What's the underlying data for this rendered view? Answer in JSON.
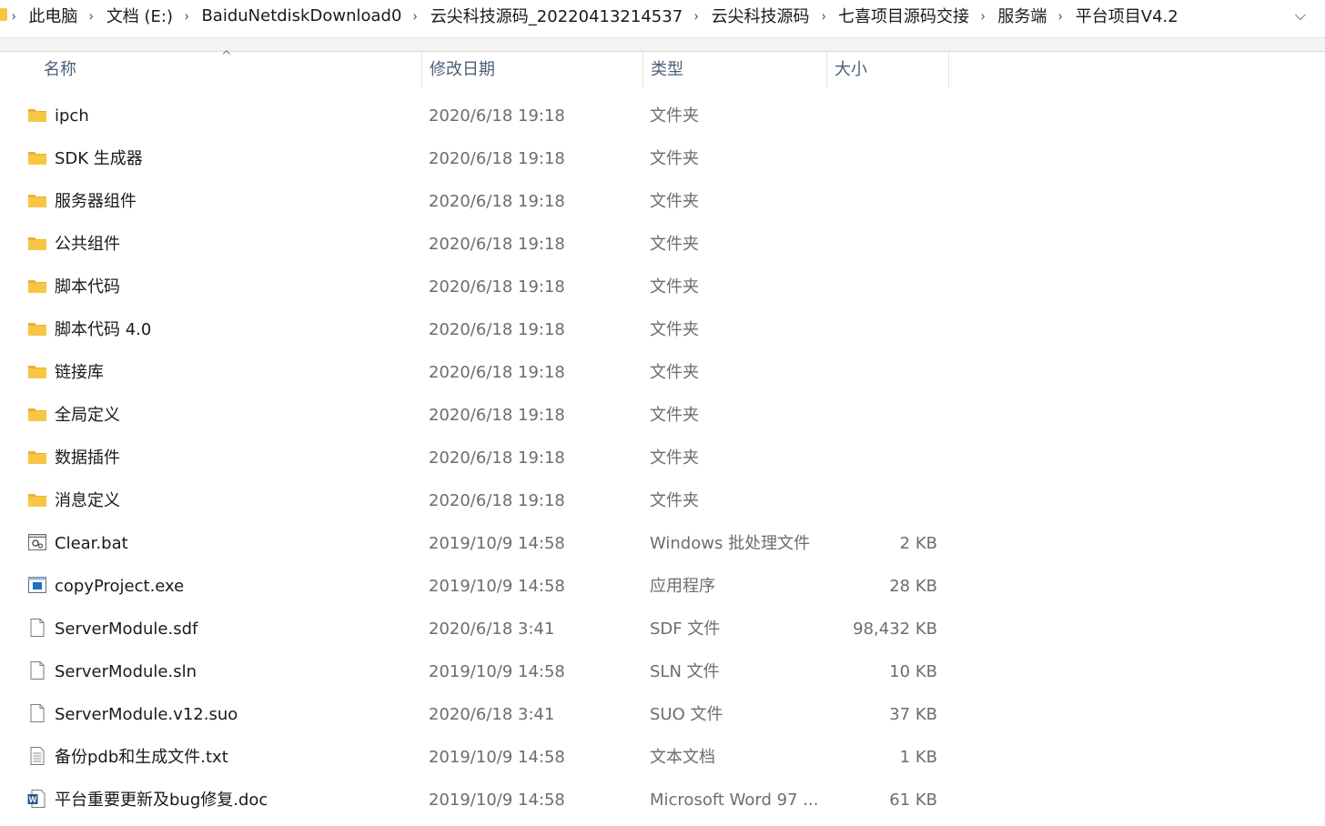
{
  "breadcrumb": {
    "items": [
      "此电脑",
      "文档 (E:)",
      "BaiduNetdiskDownload0",
      "云尖科技源码_20220413214537",
      "云尖科技源码",
      "七喜项目源码交接",
      "服务端",
      "平台项目V4.2"
    ],
    "separator": "›",
    "dropdown_glyph": "⌵"
  },
  "columns": {
    "name": "名称",
    "date": "修改日期",
    "type": "类型",
    "size": "大小",
    "sort_glyph": "^"
  },
  "files": [
    {
      "name": "ipch",
      "date": "2020/6/18 19:18",
      "type": "文件夹",
      "size": "",
      "icon": "folder-icon"
    },
    {
      "name": "SDK 生成器",
      "date": "2020/6/18 19:18",
      "type": "文件夹",
      "size": "",
      "icon": "folder-icon"
    },
    {
      "name": "服务器组件",
      "date": "2020/6/18 19:18",
      "type": "文件夹",
      "size": "",
      "icon": "folder-icon"
    },
    {
      "name": "公共组件",
      "date": "2020/6/18 19:18",
      "type": "文件夹",
      "size": "",
      "icon": "folder-icon"
    },
    {
      "name": "脚本代码",
      "date": "2020/6/18 19:18",
      "type": "文件夹",
      "size": "",
      "icon": "folder-icon"
    },
    {
      "name": "脚本代码 4.0",
      "date": "2020/6/18 19:18",
      "type": "文件夹",
      "size": "",
      "icon": "folder-icon"
    },
    {
      "name": "链接库",
      "date": "2020/6/18 19:18",
      "type": "文件夹",
      "size": "",
      "icon": "folder-icon"
    },
    {
      "name": "全局定义",
      "date": "2020/6/18 19:18",
      "type": "文件夹",
      "size": "",
      "icon": "folder-icon"
    },
    {
      "name": "数据插件",
      "date": "2020/6/18 19:18",
      "type": "文件夹",
      "size": "",
      "icon": "folder-icon"
    },
    {
      "name": "消息定义",
      "date": "2020/6/18 19:18",
      "type": "文件夹",
      "size": "",
      "icon": "folder-icon"
    },
    {
      "name": "Clear.bat",
      "date": "2019/10/9 14:58",
      "type": "Windows 批处理文件",
      "size": "2 KB",
      "icon": "batch-file-icon"
    },
    {
      "name": "copyProject.exe",
      "date": "2019/10/9 14:58",
      "type": "应用程序",
      "size": "28 KB",
      "icon": "executable-icon"
    },
    {
      "name": "ServerModule.sdf",
      "date": "2020/6/18 3:41",
      "type": "SDF 文件",
      "size": "98,432 KB",
      "icon": "blank-file-icon"
    },
    {
      "name": "ServerModule.sln",
      "date": "2019/10/9 14:58",
      "type": "SLN 文件",
      "size": "10 KB",
      "icon": "blank-file-icon"
    },
    {
      "name": "ServerModule.v12.suo",
      "date": "2020/6/18 3:41",
      "type": "SUO 文件",
      "size": "37 KB",
      "icon": "blank-file-icon"
    },
    {
      "name": "备份pdb和生成文件.txt",
      "date": "2019/10/9 14:58",
      "type": "文本文档",
      "size": "1 KB",
      "icon": "text-file-icon"
    },
    {
      "name": "平台重要更新及bug修复.doc",
      "date": "2019/10/9 14:58",
      "type": "Microsoft Word 97 ...",
      "size": "61 KB",
      "icon": "word-doc-icon"
    }
  ],
  "colors": {
    "folder": "#f7c744",
    "folder_dark": "#e8b22e",
    "header_text": "#4c607a",
    "secondary_text": "#6d6d6d",
    "exe_blue": "#1e6fc9",
    "word_blue": "#2b579a"
  }
}
